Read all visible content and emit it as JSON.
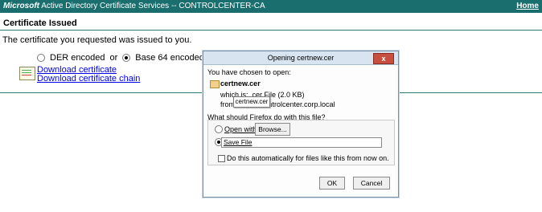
{
  "header": {
    "brand": "Microsoft",
    "title": "Active Directory Certificate Services  --  CONTROLCENTER-CA",
    "home_link": "Home"
  },
  "page": {
    "heading": "Certificate Issued",
    "message": "The certificate you requested was issued to you.",
    "encoding": {
      "der_label": "DER encoded",
      "or_label": "or",
      "base64_label": "Base 64 encoded",
      "selected": "Base 64 encoded"
    },
    "links": {
      "download_certificate": "Download certificate",
      "download_chain": "Download certificate chain"
    }
  },
  "dialog": {
    "title": "Opening certnew.cer",
    "close_label": "x",
    "chosen_label": "You have chosen to open:",
    "file_name": "certnew.cer",
    "which_is": "which is: .cer File (2.0 KB)",
    "from": "from: https://controlcenter.corp.local",
    "tooltip": "certnew.cer",
    "question": "What should Firefox do with this file?",
    "open_with_label": "Open with",
    "browse_label": "Browse...",
    "save_file_label": "Save File",
    "auto_label": "Do this automatically for files like this from now on.",
    "ok_label": "OK",
    "cancel_label": "Cancel",
    "selected_option": "Save File"
  }
}
